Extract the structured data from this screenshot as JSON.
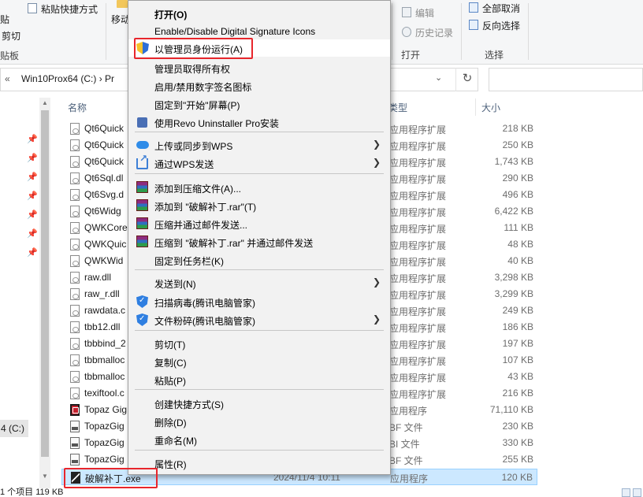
{
  "ribbon": {
    "paste_fragment": "贴",
    "paste_shortcut": "粘贴快捷方式",
    "cut": "剪切",
    "clipboard_group_fragment": "贴板",
    "move_to_fragment": "移动",
    "edit": "编辑",
    "history": "历史记录",
    "open_group": "打开",
    "select_none": "全部取消",
    "invert_selection": "反向选择",
    "select_group": "选择"
  },
  "address": {
    "chevron": "«",
    "path_visible": "Win10Prox64 (C:)   ›   Pr",
    "refresh_glyph": "↻"
  },
  "nav": {
    "drive_fragment": "4 (C:)"
  },
  "columns": {
    "name": "名称",
    "type_fragment": "类型",
    "size": "大小"
  },
  "files": [
    {
      "name": "Qt6Quick",
      "type": "应用程序扩展",
      "size": "218 KB",
      "icon": "dll"
    },
    {
      "name": "Qt6Quick",
      "type": "应用程序扩展",
      "size": "250 KB",
      "icon": "dll"
    },
    {
      "name": "Qt6Quick",
      "type": "应用程序扩展",
      "size": "1,743 KB",
      "icon": "dll"
    },
    {
      "name": "Qt6Sql.dl",
      "type": "应用程序扩展",
      "size": "290 KB",
      "icon": "dll"
    },
    {
      "name": "Qt6Svg.d",
      "type": "应用程序扩展",
      "size": "496 KB",
      "icon": "dll"
    },
    {
      "name": "Qt6Widg",
      "type": "应用程序扩展",
      "size": "6,422 KB",
      "icon": "dll"
    },
    {
      "name": "QWKCore",
      "type": "应用程序扩展",
      "size": "111 KB",
      "icon": "dll"
    },
    {
      "name": "QWKQuic",
      "type": "应用程序扩展",
      "size": "48 KB",
      "icon": "dll"
    },
    {
      "name": "QWKWid",
      "type": "应用程序扩展",
      "size": "40 KB",
      "icon": "dll"
    },
    {
      "name": "raw.dll",
      "type": "应用程序扩展",
      "size": "3,298 KB",
      "icon": "dll"
    },
    {
      "name": "raw_r.dll",
      "type": "应用程序扩展",
      "size": "3,299 KB",
      "icon": "dll"
    },
    {
      "name": "rawdata.c",
      "type": "应用程序扩展",
      "size": "249 KB",
      "icon": "dll"
    },
    {
      "name": "tbb12.dll",
      "type": "应用程序扩展",
      "size": "186 KB",
      "icon": "dll"
    },
    {
      "name": "tbbbind_2",
      "type": "应用程序扩展",
      "size": "197 KB",
      "icon": "dll"
    },
    {
      "name": "tbbmalloc",
      "type": "应用程序扩展",
      "size": "107 KB",
      "icon": "dll"
    },
    {
      "name": "tbbmalloc",
      "type": "应用程序扩展",
      "size": "43 KB",
      "icon": "dll"
    },
    {
      "name": "texiftool.c",
      "type": "应用程序扩展",
      "size": "216 KB",
      "icon": "dll"
    },
    {
      "name": "Topaz Gig",
      "type": "应用程序",
      "size": "71,110 KB",
      "icon": "exe-red"
    },
    {
      "name": "TopazGig",
      "type": "BF 文件",
      "size": "230 KB",
      "icon": "bf"
    },
    {
      "name": "TopazGig",
      "type": "BI 文件",
      "size": "330 KB",
      "icon": "bf"
    },
    {
      "name": "TopazGig",
      "type": "BF 文件",
      "size": "255 KB",
      "icon": "bf"
    }
  ],
  "selected_file": {
    "name": "破解补丁.exe",
    "date": "2024/11/4 10:11",
    "type": "应用程序",
    "size": "120 KB"
  },
  "status": {
    "text": "1 个项目   119 KB"
  },
  "context_menu": [
    {
      "label": "打开(O)",
      "bold": true,
      "icon": "",
      "submenu": false
    },
    {
      "label": "Enable/Disable Digital Signature Icons",
      "icon": "",
      "submenu": false
    },
    {
      "label": "以管理员身份运行(A)",
      "icon": "uac-shield-icon",
      "submenu": false,
      "hover": true
    },
    {
      "label": "管理员取得所有权",
      "icon": "",
      "submenu": false
    },
    {
      "label": "启用/禁用数字签名图标",
      "icon": "",
      "submenu": false
    },
    {
      "label": "固定到\"开始\"屏幕(P)",
      "icon": "",
      "submenu": false
    },
    {
      "label": "使用Revo Uninstaller Pro安装",
      "icon": "revo-icon",
      "submenu": false
    },
    {
      "label": "上传或同步到WPS",
      "icon": "wps-cloud-icon",
      "submenu": true
    },
    {
      "label": "通过WPS发送",
      "icon": "wps-share-icon",
      "submenu": true
    },
    {
      "label": "添加到压缩文件(A)...",
      "icon": "winrar-icon",
      "submenu": false
    },
    {
      "label": "添加到 \"破解补丁.rar\"(T)",
      "icon": "winrar-icon",
      "submenu": false
    },
    {
      "label": "压缩并通过邮件发送...",
      "icon": "winrar-icon",
      "submenu": false
    },
    {
      "label": "压缩到 \"破解补丁.rar\" 并通过邮件发送",
      "icon": "winrar-icon",
      "submenu": false
    },
    {
      "label": "固定到任务栏(K)",
      "icon": "",
      "submenu": false
    },
    {
      "label": "发送到(N)",
      "icon": "",
      "submenu": true
    },
    {
      "label": "扫描病毒(腾讯电脑管家)",
      "icon": "tencent-shield-icon",
      "submenu": false
    },
    {
      "label": "文件粉碎(腾讯电脑管家)",
      "icon": "tencent-shield-icon",
      "submenu": true
    },
    {
      "label": "剪切(T)",
      "icon": "",
      "submenu": false
    },
    {
      "label": "复制(C)",
      "icon": "",
      "submenu": false
    },
    {
      "label": "粘贴(P)",
      "icon": "",
      "submenu": false
    },
    {
      "label": "创建快捷方式(S)",
      "icon": "",
      "submenu": false
    },
    {
      "label": "删除(D)",
      "icon": "",
      "submenu": false
    },
    {
      "label": "重命名(M)",
      "icon": "",
      "submenu": false
    },
    {
      "label": "属性(R)",
      "icon": "",
      "submenu": false
    }
  ],
  "colors": {
    "highlight_box": "#e8262c",
    "selection_fill": "#cce8ff",
    "menu_background": "#f2f2f2"
  }
}
